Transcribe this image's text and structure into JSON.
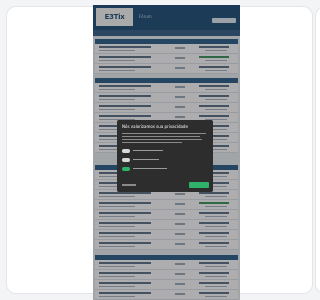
{
  "site": {
    "logo_text": "E3Tix",
    "header_text": "Fórum"
  },
  "modal": {
    "title": "Nós valorizamos sua privacidade"
  }
}
